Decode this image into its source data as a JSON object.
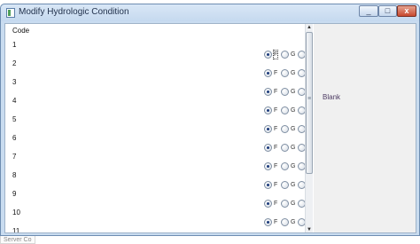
{
  "window": {
    "title": "Modify Hydrologic Condition",
    "controls": {
      "minimize": "_",
      "maximize": "□",
      "close": "x"
    }
  },
  "grid": {
    "header": "Code",
    "rows": [
      {
        "code": "1",
        "selected": "F"
      },
      {
        "code": "2",
        "selected": "F"
      },
      {
        "code": "3",
        "selected": "F"
      },
      {
        "code": "4",
        "selected": "F"
      },
      {
        "code": "5",
        "selected": "F"
      },
      {
        "code": "6",
        "selected": "F"
      },
      {
        "code": "7",
        "selected": "F"
      },
      {
        "code": "8",
        "selected": "F"
      },
      {
        "code": "9",
        "selected": "F"
      },
      {
        "code": "10",
        "selected": "F"
      },
      {
        "code": "11",
        "selected": "F"
      }
    ],
    "options": [
      "F",
      "G",
      ""
    ]
  },
  "side_panel": {
    "text": "Blank"
  },
  "taskbar": {
    "text": "Server Co"
  },
  "colors": {
    "title_bar": "#c5d9ef",
    "window_border": "#6e8db1",
    "side_panel": "#f0f0f0",
    "blank_text": "#4c3a62",
    "selected_radio_dot": "#1b3a7b"
  },
  "scrollbar": {
    "thumb_position": "top",
    "icons": [
      "scroll-up-arrow-icon",
      "scroll-down-arrow-icon"
    ]
  }
}
